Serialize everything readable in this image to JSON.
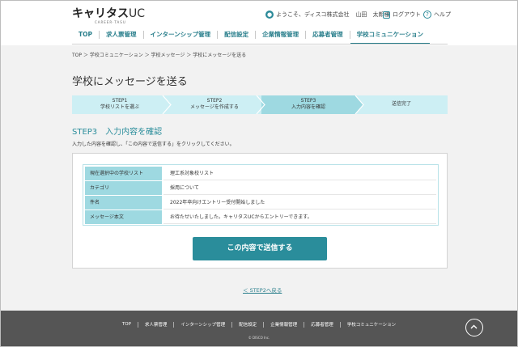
{
  "header": {
    "logo_main": "キャリタス",
    "logo_uc": "UC",
    "logo_sub": "CAREER·TASU",
    "greeting": "ようこそ、ディスコ株式会社",
    "user_name": "山田　太郎様",
    "logout_label": "ログアウト",
    "help_label": "ヘルプ"
  },
  "nav": {
    "items": [
      {
        "label": "TOP"
      },
      {
        "label": "求人票管理"
      },
      {
        "label": "インターンシップ管理"
      },
      {
        "label": "配信設定"
      },
      {
        "label": "企業情報管理"
      },
      {
        "label": "応募者管理"
      },
      {
        "label": "学校コミュニケーション"
      }
    ],
    "active_index": 6
  },
  "breadcrumb": "TOP ＞ 学校コミュニケーション ＞ 学校メッセージ ＞ 学校にメッセージを送る",
  "page_title": "学校にメッセージを送る",
  "steps": [
    {
      "line1": "STEP1",
      "line2": "学校リストを選ぶ"
    },
    {
      "line1": "STEP2",
      "line2": "メッセージを作成する"
    },
    {
      "line1": "STEP3",
      "line2": "入力内容を確認"
    },
    {
      "line1": "",
      "line2": "送信完了"
    }
  ],
  "step_heading": "STEP3　入力内容を確認",
  "instruction": "入力した内容を確認し、「この内容で送信する」をクリックしてください。",
  "confirm_table": [
    {
      "label": "現在選択中の学校リスト",
      "value": "理工系対象校リスト"
    },
    {
      "label": "カテゴリ",
      "value": "採用について"
    },
    {
      "label": "件名",
      "value": "2022年卒向けエントリー受付開始しました"
    },
    {
      "label": "メッセージ本文",
      "value": "お待たせいたしました。キャリタスUCからエントリーできます。"
    }
  ],
  "submit_label": "この内容で送信する",
  "back_link": "＜ STEP2へ戻る",
  "footer": {
    "links": [
      "TOP",
      "求人票管理",
      "インターンシップ管理",
      "配信設定",
      "企業情報管理",
      "応募者管理",
      "学校コミュニケーション"
    ],
    "copyright": "© DISCO Inc."
  },
  "colors": {
    "accent": "#2a8d9b",
    "step_bg": "#cdeff4",
    "step_active": "#9ed9e1",
    "footer_bg": "#555555"
  }
}
